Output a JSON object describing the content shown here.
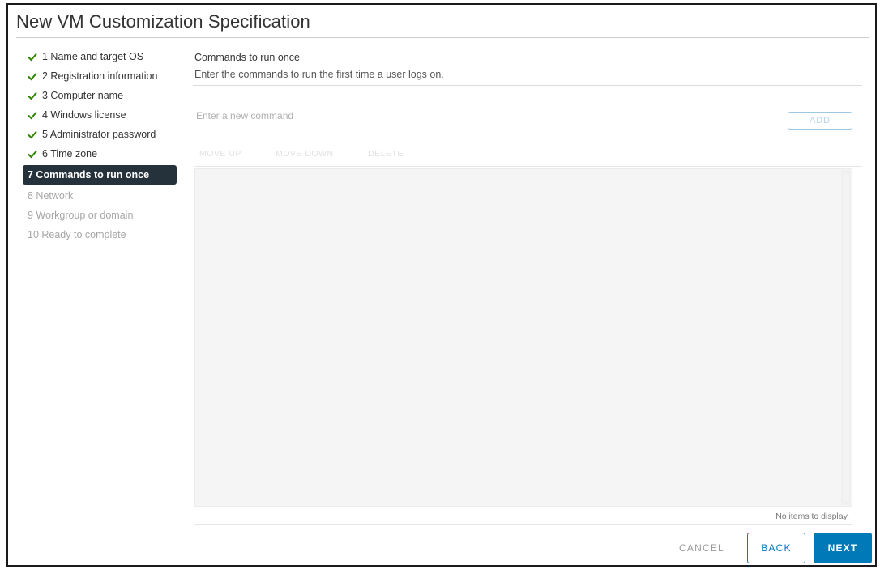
{
  "dialog": {
    "title": "New VM Customization Specification"
  },
  "steps": [
    {
      "label": "1 Name and target OS",
      "state": "complete"
    },
    {
      "label": "2 Registration information",
      "state": "complete"
    },
    {
      "label": "3 Computer name",
      "state": "complete"
    },
    {
      "label": "4 Windows license",
      "state": "complete"
    },
    {
      "label": "5 Administrator password",
      "state": "complete"
    },
    {
      "label": "6 Time zone",
      "state": "complete"
    },
    {
      "label": "7 Commands to run once",
      "state": "active"
    },
    {
      "label": "8 Network",
      "state": "disabled"
    },
    {
      "label": "9 Workgroup or domain",
      "state": "disabled"
    },
    {
      "label": "10 Ready to complete",
      "state": "disabled"
    }
  ],
  "content": {
    "section_title": "Commands to run once",
    "section_description": "Enter the commands to run the first time a user logs on.",
    "command_input": {
      "placeholder": "Enter a new command",
      "value": ""
    },
    "add_label": "ADD",
    "grid_tools": [
      "MOVE UP",
      "MOVE DOWN",
      "DELETE"
    ],
    "grid_footer": "No items to display."
  },
  "footer": {
    "cancel_label": "CANCEL",
    "back_label": "BACK",
    "next_label": "NEXT"
  },
  "colors": {
    "accent": "#0079b8",
    "active_step_bg": "#25313b",
    "check_green": "#2f8400"
  }
}
